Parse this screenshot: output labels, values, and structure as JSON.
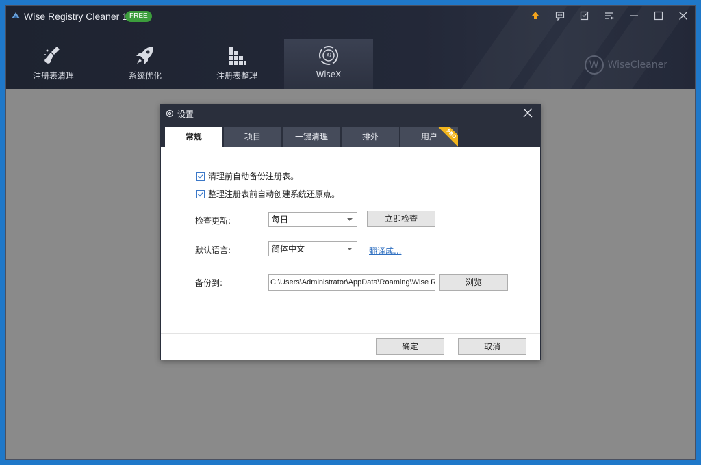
{
  "window": {
    "title": "Wise Registry Cleaner 11",
    "badge": "FREE",
    "toolbar_icons": [
      "upgrade-icon",
      "feedback-icon",
      "notes-icon",
      "menu-icon",
      "minimize-icon",
      "maximize-icon",
      "close-icon"
    ]
  },
  "nav": {
    "items": [
      {
        "label": "注册表清理",
        "icon": "broom-icon"
      },
      {
        "label": "系统优化",
        "icon": "rocket-icon"
      },
      {
        "label": "注册表整理",
        "icon": "grid-icon"
      },
      {
        "label": "WiseX",
        "icon": "wisex-icon",
        "active": true
      }
    ]
  },
  "brand": {
    "text": "WiseCleaner",
    "mark": "W"
  },
  "dialog": {
    "title": "设置",
    "tabs": [
      {
        "label": "常规",
        "active": true
      },
      {
        "label": "项目"
      },
      {
        "label": "一键清理"
      },
      {
        "label": "排外"
      },
      {
        "label": "用户",
        "badge": "PRO"
      }
    ],
    "options": {
      "backup_registry": {
        "label": "清理前自动备份注册表。",
        "checked": true
      },
      "restore_point": {
        "label": "整理注册表前自动创建系统还原点。",
        "checked": true
      }
    },
    "update": {
      "label": "检查更新:",
      "value": "每日",
      "button": "立即检查"
    },
    "language": {
      "label": "默认语言:",
      "value": "简体中文",
      "link": "翻译成..."
    },
    "backup": {
      "label": "备份到:",
      "path": "C:\\Users\\Administrator\\AppData\\Roaming\\Wise R",
      "button": "浏览"
    },
    "ok_label": "确定",
    "cancel_label": "取消"
  },
  "colors": {
    "header_bg": "#232838",
    "badge_green": "#3c9d3c",
    "accent_orange": "#f2a31d",
    "link_blue": "#2f6fc0",
    "pro_yellow": "#f2b51d"
  }
}
